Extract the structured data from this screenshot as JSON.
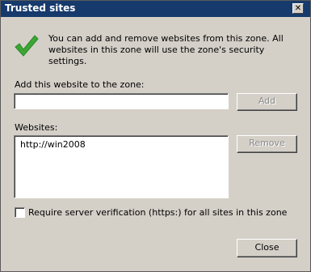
{
  "window": {
    "title": "Trusted sites",
    "close_glyph": "✕"
  },
  "info": {
    "icon": "green-checkmark-icon",
    "text": "You can add and remove websites from this zone. All websites in this zone will use the zone's security settings."
  },
  "add_section": {
    "label": "Add this website to the zone:",
    "input_value": "",
    "add_button": "Add"
  },
  "websites_section": {
    "label": "Websites:",
    "items": [
      "http://win2008"
    ],
    "remove_button": "Remove"
  },
  "verification": {
    "label": "Require server verification (https:) for all sites in this zone",
    "checked": false
  },
  "close_button": "Close",
  "colors": {
    "title_bar": "#163a6b",
    "dialog_bg": "#d4d0c8",
    "check_green": "#3ca635"
  }
}
